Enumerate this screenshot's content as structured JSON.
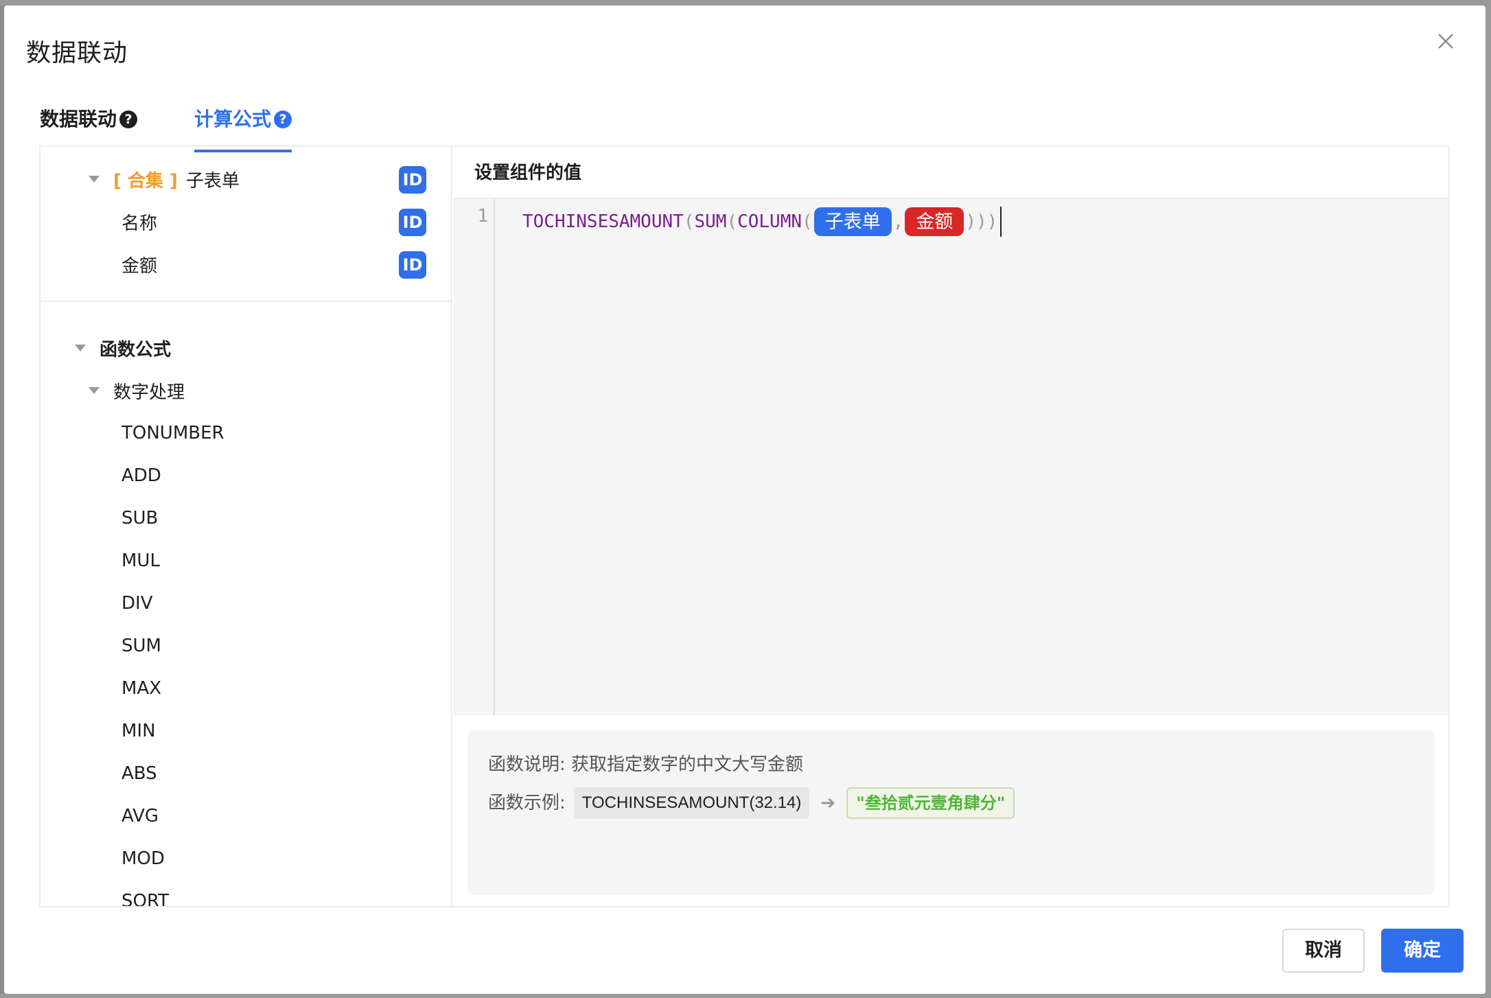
{
  "dialog": {
    "title": "数据联动",
    "close_icon": "close-icon"
  },
  "tabs": [
    {
      "label": "数据联动",
      "help": "?",
      "active": false
    },
    {
      "label": "计算公式",
      "help": "?",
      "active": true
    }
  ],
  "fields_tree": {
    "collection_prefix": "[ 合集 ]",
    "collection_name": "子表单",
    "id_badge": "ID",
    "children": [
      "名称",
      "金额"
    ]
  },
  "functions_tree": {
    "group_label": "函数公式",
    "category_label": "数字处理",
    "items": [
      "TONUMBER",
      "ADD",
      "SUB",
      "MUL",
      "DIV",
      "SUM",
      "MAX",
      "MIN",
      "ABS",
      "AVG",
      "MOD",
      "SQRT"
    ]
  },
  "editor": {
    "header": "设置组件的值",
    "line_number": "1",
    "tokens": {
      "fn1": "TOCHINSESAMOUNT",
      "fn2": "SUM",
      "fn3": "COLUMN",
      "open_paren": "(",
      "field_1": "子表单",
      "comma": ",",
      "field_2": "金额",
      "close_parens": ")))"
    }
  },
  "description": {
    "desc_text": "函数说明: 获取指定数字的中文大写金额",
    "example_label": "函数示例:",
    "example_code": "TOCHINSESAMOUNT(32.14)",
    "arrow": "➔",
    "example_result": "\"叁拾贰元壹角肆分\""
  },
  "footer": {
    "cancel_label": "取消",
    "ok_label": "确定"
  },
  "colors": {
    "accent": "#2f6fec",
    "field_red": "#d92727",
    "collection_orange": "#f39c2b",
    "function_purple": "#7b1f8f",
    "result_green": "#52b43a"
  }
}
